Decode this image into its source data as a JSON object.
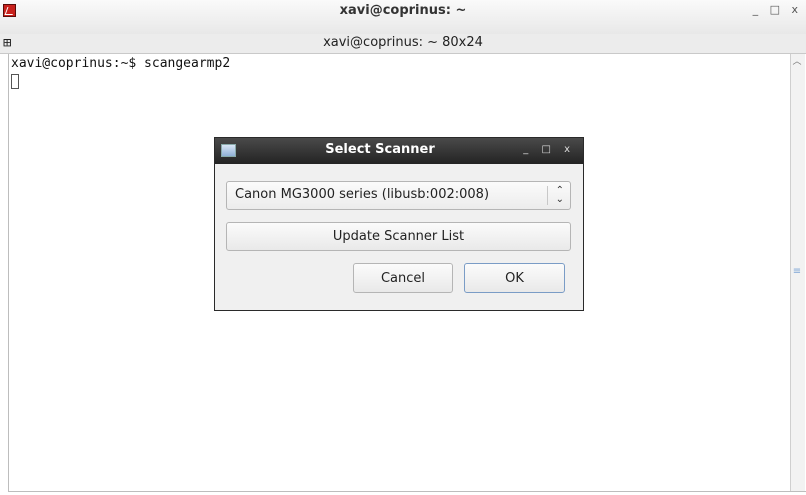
{
  "terminal_window": {
    "title": "xavi@coprinus: ~",
    "controls": "_ □ x",
    "tab_title": "xavi@coprinus: ~ 80x24",
    "tab_icon": "split-view-icon",
    "command_line": "xavi@coprinus:~$ scangearmp2"
  },
  "dialog": {
    "title": "Select Scanner",
    "controls": "_ □ x",
    "scanner_select_value": "Canon MG3000 series (libusb:002:008)",
    "update_label": "Update Scanner List",
    "cancel_label": "Cancel",
    "ok_label": "OK"
  },
  "colors": {
    "terminal_icon": "#c8211c",
    "dialog_titlebar": "#2b2b2b",
    "dialog_bg": "#f0f0f0",
    "ok_border": "#7a9cc6"
  }
}
